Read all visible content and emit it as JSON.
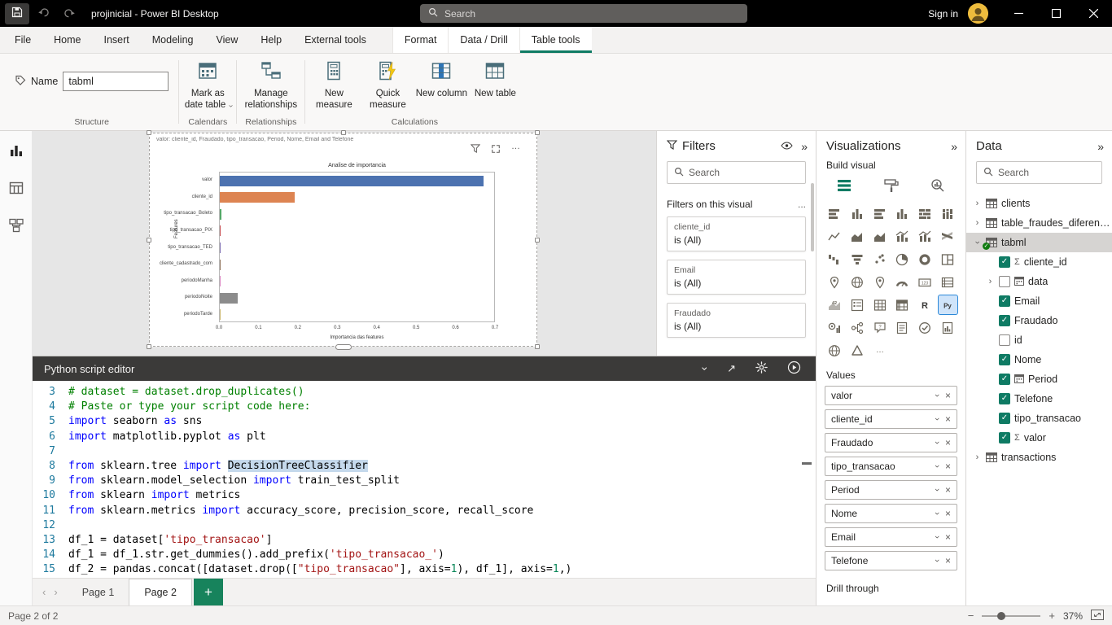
{
  "colors": {
    "accent_teal": "#0f7b64",
    "selection_blue": "#2b88d8",
    "titlebar_black": "#000000",
    "add_page_green": "#17835c"
  },
  "titlebar": {
    "app_title": "projinicial - Power BI Desktop",
    "search_placeholder": "Search",
    "sign_in_label": "Sign in"
  },
  "ribbon": {
    "tabs": [
      "File",
      "Home",
      "Insert",
      "Modeling",
      "View",
      "Help",
      "External tools"
    ],
    "contextual_tabs": [
      "Format",
      "Data / Drill",
      "Table tools"
    ],
    "active_tab": "Table tools",
    "name_label": "Name",
    "name_value": "tabml",
    "group_labels": [
      "Structure",
      "Calendars",
      "Relationships",
      "Calculations"
    ],
    "buttons": [
      {
        "label": "Mark as date table"
      },
      {
        "label": "Manage relationships"
      },
      {
        "label": "New measure"
      },
      {
        "label": "Quick measure"
      },
      {
        "label": "New column"
      },
      {
        "label": "New table"
      }
    ]
  },
  "canvas": {
    "visual_title": "valor: cliente_id, Fraudado, tipo_transacao, Period, Nome, Email and Telefone"
  },
  "chart_data": {
    "type": "bar",
    "orientation": "horizontal",
    "title": "Analise de importancia",
    "xlabel": "Importancia das features",
    "ylabel": "Features",
    "xlim": [
      0,
      0.7
    ],
    "xticks": [
      0.0,
      0.1,
      0.2,
      0.3,
      0.4,
      0.5,
      0.6,
      0.7
    ],
    "grid": false,
    "legend": false,
    "categories": [
      "valor",
      "cliente_id",
      "tipo_transacao_Boleto",
      "tipo_transacao_PIX",
      "tipo_transacao_TED",
      "cliente_cadastrado_com",
      "periodoManha",
      "periodoNoite",
      "periodoTarde"
    ],
    "values": [
      0.67,
      0.19,
      0.004,
      0.003,
      0.002,
      0.002,
      0.002,
      0.045,
      0.002
    ],
    "colors": [
      "#4c72b0",
      "#dd8452",
      "#55a868",
      "#c44e52",
      "#8172b3",
      "#937860",
      "#da8bc3",
      "#8c8c8c",
      "#ccb974"
    ]
  },
  "python_editor": {
    "title": "Python script editor",
    "lines": [
      {
        "num": 3,
        "segs": [
          {
            "c": "com",
            "t": "# dataset = dataset.drop_duplicates()"
          }
        ]
      },
      {
        "num": 4,
        "segs": [
          {
            "c": "com",
            "t": "# Paste or type your script code here:"
          }
        ]
      },
      {
        "num": 5,
        "segs": [
          {
            "c": "kw",
            "t": "import"
          },
          {
            "t": " seaborn "
          },
          {
            "c": "kw",
            "t": "as"
          },
          {
            "t": " sns"
          }
        ]
      },
      {
        "num": 6,
        "segs": [
          {
            "c": "kw",
            "t": "import"
          },
          {
            "t": " matplotlib.pyplot "
          },
          {
            "c": "kw",
            "t": "as"
          },
          {
            "t": " plt"
          }
        ]
      },
      {
        "num": 7,
        "segs": []
      },
      {
        "num": 8,
        "segs": [
          {
            "c": "kw",
            "t": "from"
          },
          {
            "t": " sklearn.tree "
          },
          {
            "c": "kw",
            "t": "import"
          },
          {
            "t": " "
          },
          {
            "c": "hl",
            "t": "DecisionTreeClassifier"
          }
        ]
      },
      {
        "num": 9,
        "segs": [
          {
            "c": "kw",
            "t": "from"
          },
          {
            "t": " sklearn.model_selection "
          },
          {
            "c": "kw",
            "t": "import"
          },
          {
            "t": " train_test_split"
          }
        ]
      },
      {
        "num": 10,
        "segs": [
          {
            "c": "kw",
            "t": "from"
          },
          {
            "t": " sklearn "
          },
          {
            "c": "kw",
            "t": "import"
          },
          {
            "t": " metrics"
          }
        ]
      },
      {
        "num": 11,
        "segs": [
          {
            "c": "kw",
            "t": "from"
          },
          {
            "t": " sklearn.metrics "
          },
          {
            "c": "kw",
            "t": "import"
          },
          {
            "t": " accuracy_score, precision_score, recall_score"
          }
        ]
      },
      {
        "num": 12,
        "segs": []
      },
      {
        "num": 13,
        "segs": [
          {
            "t": "df_1 = dataset["
          },
          {
            "c": "str",
            "t": "'tipo_transacao'"
          },
          {
            "t": "]"
          }
        ]
      },
      {
        "num": 14,
        "segs": [
          {
            "t": "df_1 = df_1.str.get_dummies().add_prefix("
          },
          {
            "c": "str",
            "t": "'tipo_transacao_'"
          },
          {
            "t": ")"
          }
        ]
      },
      {
        "num": 15,
        "segs": [
          {
            "t": "df_2 = pandas.concat([dataset.drop(["
          },
          {
            "c": "str",
            "t": "\"tipo_transacao\""
          },
          {
            "t": "], axis="
          },
          {
            "c": "num",
            "t": "1"
          },
          {
            "t": "), df_1], axis="
          },
          {
            "c": "num",
            "t": "1"
          },
          {
            "t": ",)"
          }
        ]
      }
    ]
  },
  "filters_pane": {
    "title": "Filters",
    "search_placeholder": "Search",
    "section_label": "Filters on this visual",
    "more_label": "...",
    "cards": [
      {
        "field": "cliente_id",
        "condition": "is (All)"
      },
      {
        "field": "Email",
        "condition": "is (All)"
      },
      {
        "field": "Fraudado",
        "condition": "is (All)"
      }
    ]
  },
  "visualizations_pane": {
    "title": "Visualizations",
    "build_label": "Build visual",
    "values_label": "Values",
    "drill_through_label": "Drill through",
    "selected_visual": "python-visual",
    "visual_types": [
      {
        "name": "stacked-bar-chart",
        "kind": "bars"
      },
      {
        "name": "stacked-column-chart",
        "kind": "cols"
      },
      {
        "name": "clustered-bar-chart",
        "kind": "bars"
      },
      {
        "name": "clustered-column-chart",
        "kind": "cols"
      },
      {
        "name": "100-stacked-bar-chart",
        "kind": "bars100"
      },
      {
        "name": "100-stacked-column-chart",
        "kind": "cols100"
      },
      {
        "name": "line-chart",
        "kind": "line"
      },
      {
        "name": "area-chart",
        "kind": "area"
      },
      {
        "name": "stacked-area-chart",
        "kind": "area"
      },
      {
        "name": "line-and-stacked-column-chart",
        "kind": "combo"
      },
      {
        "name": "line-and-clustered-column-chart",
        "kind": "combo"
      },
      {
        "name": "ribbon-chart",
        "kind": "ribbon"
      },
      {
        "name": "waterfall-chart",
        "kind": "waterfall"
      },
      {
        "name": "funnel-chart",
        "kind": "funnel"
      },
      {
        "name": "scatter-chart",
        "kind": "scatter"
      },
      {
        "name": "pie-chart",
        "kind": "pie"
      },
      {
        "name": "donut-chart",
        "kind": "donut"
      },
      {
        "name": "treemap",
        "kind": "treemap"
      },
      {
        "name": "map",
        "kind": "map"
      },
      {
        "name": "filled-map",
        "kind": "globe"
      },
      {
        "name": "azure-map",
        "kind": "map"
      },
      {
        "name": "gauge",
        "kind": "gauge"
      },
      {
        "name": "card",
        "kind": "card123"
      },
      {
        "name": "multi-row-card",
        "kind": "cardrows"
      },
      {
        "name": "kpi",
        "kind": "kpi"
      },
      {
        "name": "slicer",
        "kind": "slicer"
      },
      {
        "name": "table",
        "kind": "tablegrid"
      },
      {
        "name": "matrix",
        "kind": "matrix"
      },
      {
        "name": "r-script-visual",
        "kind": "textR"
      },
      {
        "name": "python-visual",
        "kind": "textPy",
        "selected": true
      },
      {
        "name": "key-influencers",
        "kind": "influencers"
      },
      {
        "name": "decomposition-tree",
        "kind": "tree"
      },
      {
        "name": "qa",
        "kind": "qa"
      },
      {
        "name": "smart-narrative",
        "kind": "narrative"
      },
      {
        "name": "metrics",
        "kind": "metric"
      },
      {
        "name": "paginated-report",
        "kind": "paginated"
      },
      {
        "name": "arcgis-map",
        "kind": "globe"
      },
      {
        "name": "power-apps",
        "kind": "papp"
      },
      {
        "name": "more-options",
        "kind": "dots"
      }
    ],
    "value_fields": [
      "valor",
      "cliente_id",
      "Fraudado",
      "tipo_transacao",
      "Period",
      "Nome",
      "Email",
      "Telefone"
    ]
  },
  "data_pane": {
    "title": "Data",
    "search_placeholder": "Search",
    "tables": [
      {
        "name": "clients"
      },
      {
        "name": "table_fraudes_diferenca..."
      },
      {
        "name": "tabml",
        "selected": true,
        "expanded": true,
        "fields": [
          {
            "name": "cliente_id",
            "checked": true,
            "icon": "sigma"
          },
          {
            "name": "data",
            "checked": false,
            "icon": "calendar",
            "expandable": true
          },
          {
            "name": "Email",
            "checked": true
          },
          {
            "name": "Fraudado",
            "checked": true
          },
          {
            "name": "id",
            "checked": false
          },
          {
            "name": "Nome",
            "checked": true
          },
          {
            "name": "Period",
            "checked": true,
            "icon": "calendar"
          },
          {
            "name": "Telefone",
            "checked": true
          },
          {
            "name": "tipo_transacao",
            "checked": true
          },
          {
            "name": "valor",
            "checked": true,
            "icon": "sigma"
          }
        ]
      },
      {
        "name": "transactions"
      }
    ]
  },
  "pages": {
    "tabs": [
      "Page 1",
      "Page 2"
    ],
    "active": "Page 2"
  },
  "statusbar": {
    "page_indicator": "Page 2 of 2",
    "zoom": "37%"
  }
}
